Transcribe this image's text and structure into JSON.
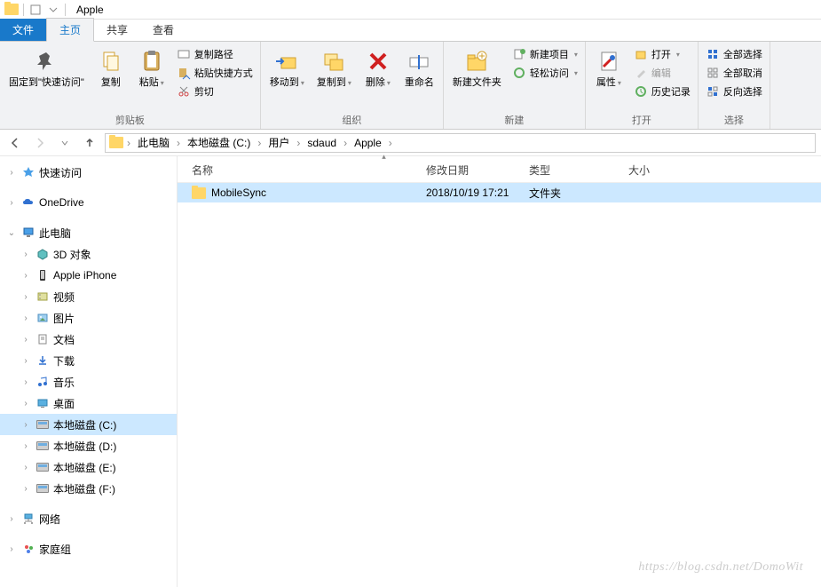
{
  "window": {
    "title": "Apple"
  },
  "tabs": {
    "file": "文件",
    "home": "主页",
    "share": "共享",
    "view": "查看"
  },
  "ribbon": {
    "pin": "固定到\"快速访问\"",
    "copy": "复制",
    "paste": "粘贴",
    "copyPath": "复制路径",
    "pasteShortcut": "粘贴快捷方式",
    "cut": "剪切",
    "clipboardLabel": "剪贴板",
    "moveTo": "移动到",
    "copyTo": "复制到",
    "delete": "删除",
    "rename": "重命名",
    "organizeLabel": "组织",
    "newFolder": "新建文件夹",
    "newItem": "新建项目",
    "easyAccess": "轻松访问",
    "newLabel": "新建",
    "properties": "属性",
    "open": "打开",
    "edit": "编辑",
    "history": "历史记录",
    "openLabel": "打开",
    "selectAll": "全部选择",
    "selectNone": "全部取消",
    "invertSelection": "反向选择",
    "selectLabel": "选择"
  },
  "breadcrumbs": [
    "此电脑",
    "本地磁盘 (C:)",
    "用户",
    "sdaud",
    "Apple"
  ],
  "columns": {
    "name": "名称",
    "date": "修改日期",
    "type": "类型",
    "size": "大小"
  },
  "files": [
    {
      "name": "MobileSync",
      "date": "2018/10/19 17:21",
      "type": "文件夹",
      "size": ""
    }
  ],
  "tree": {
    "quickAccess": "快速访问",
    "oneDrive": "OneDrive",
    "thisPC": "此电脑",
    "objects3d": "3D 对象",
    "iphone": "Apple iPhone",
    "videos": "视频",
    "pictures": "图片",
    "documents": "文档",
    "downloads": "下载",
    "music": "音乐",
    "desktop": "桌面",
    "diskC": "本地磁盘 (C:)",
    "diskD": "本地磁盘 (D:)",
    "diskE": "本地磁盘 (E:)",
    "diskF": "本地磁盘 (F:)",
    "network": "网络",
    "homegroup": "家庭组"
  },
  "watermark": "https://blog.csdn.net/DomoWit"
}
